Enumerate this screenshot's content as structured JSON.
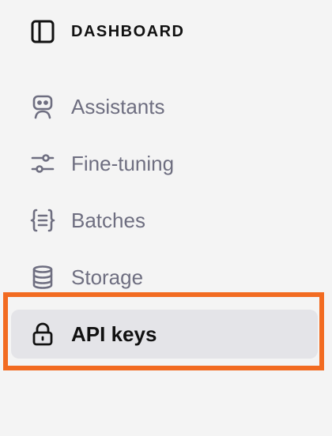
{
  "header": {
    "title": "DASHBOARD",
    "icon": "sidebar-panel-icon"
  },
  "nav": {
    "items": [
      {
        "label": "Assistants",
        "icon": "robot-icon",
        "active": false
      },
      {
        "label": "Fine-tuning",
        "icon": "sliders-icon",
        "active": false
      },
      {
        "label": "Batches",
        "icon": "braces-list-icon",
        "active": false
      },
      {
        "label": "Storage",
        "icon": "database-icon",
        "active": false
      },
      {
        "label": "API keys",
        "icon": "lock-icon",
        "active": true
      }
    ]
  },
  "colors": {
    "background": "#f4f4f4",
    "active_background": "#e4e4e8",
    "muted_text": "#6e6e80",
    "primary_text": "#111111",
    "highlight": "#f26b21"
  }
}
